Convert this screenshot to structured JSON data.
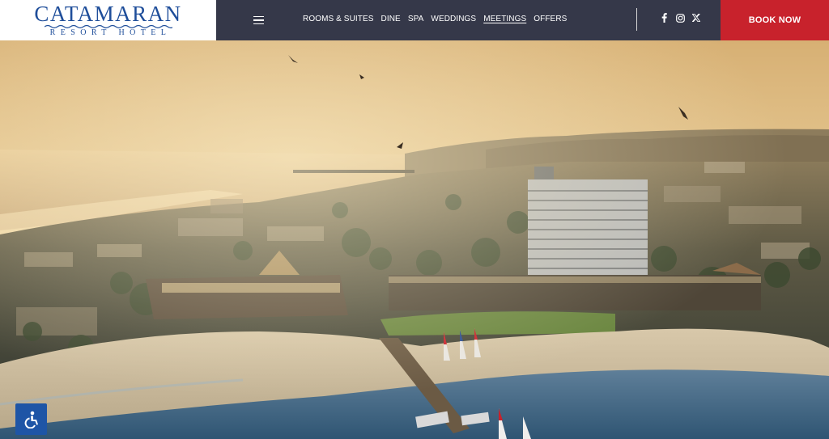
{
  "brand": {
    "name": "CATAMARAN",
    "tagline": "RESORT HOTEL",
    "color": "#1f4e9a"
  },
  "header": {
    "menu_icon": "hamburger-menu-icon",
    "nav": [
      {
        "label": "ROOMS & SUITES",
        "active": false
      },
      {
        "label": "DINE",
        "active": false
      },
      {
        "label": "SPA",
        "active": false
      },
      {
        "label": "WEDDINGS",
        "active": false
      },
      {
        "label": "MEETINGS",
        "active": true
      },
      {
        "label": "OFFERS",
        "active": false
      }
    ],
    "social": [
      {
        "icon": "facebook-icon",
        "glyph": "f"
      },
      {
        "icon": "instagram-icon",
        "glyph": "◎"
      },
      {
        "icon": "x-twitter-icon",
        "glyph": "𝕏"
      }
    ],
    "book_label": "BOOK NOW",
    "background": "#353849",
    "accent": "#c8222c"
  },
  "hero": {
    "image": "aerial-view-of-resort-and-bay-at-sunset"
  },
  "accessibility": {
    "icon": "accessibility-icon",
    "color": "#1e55a6"
  }
}
